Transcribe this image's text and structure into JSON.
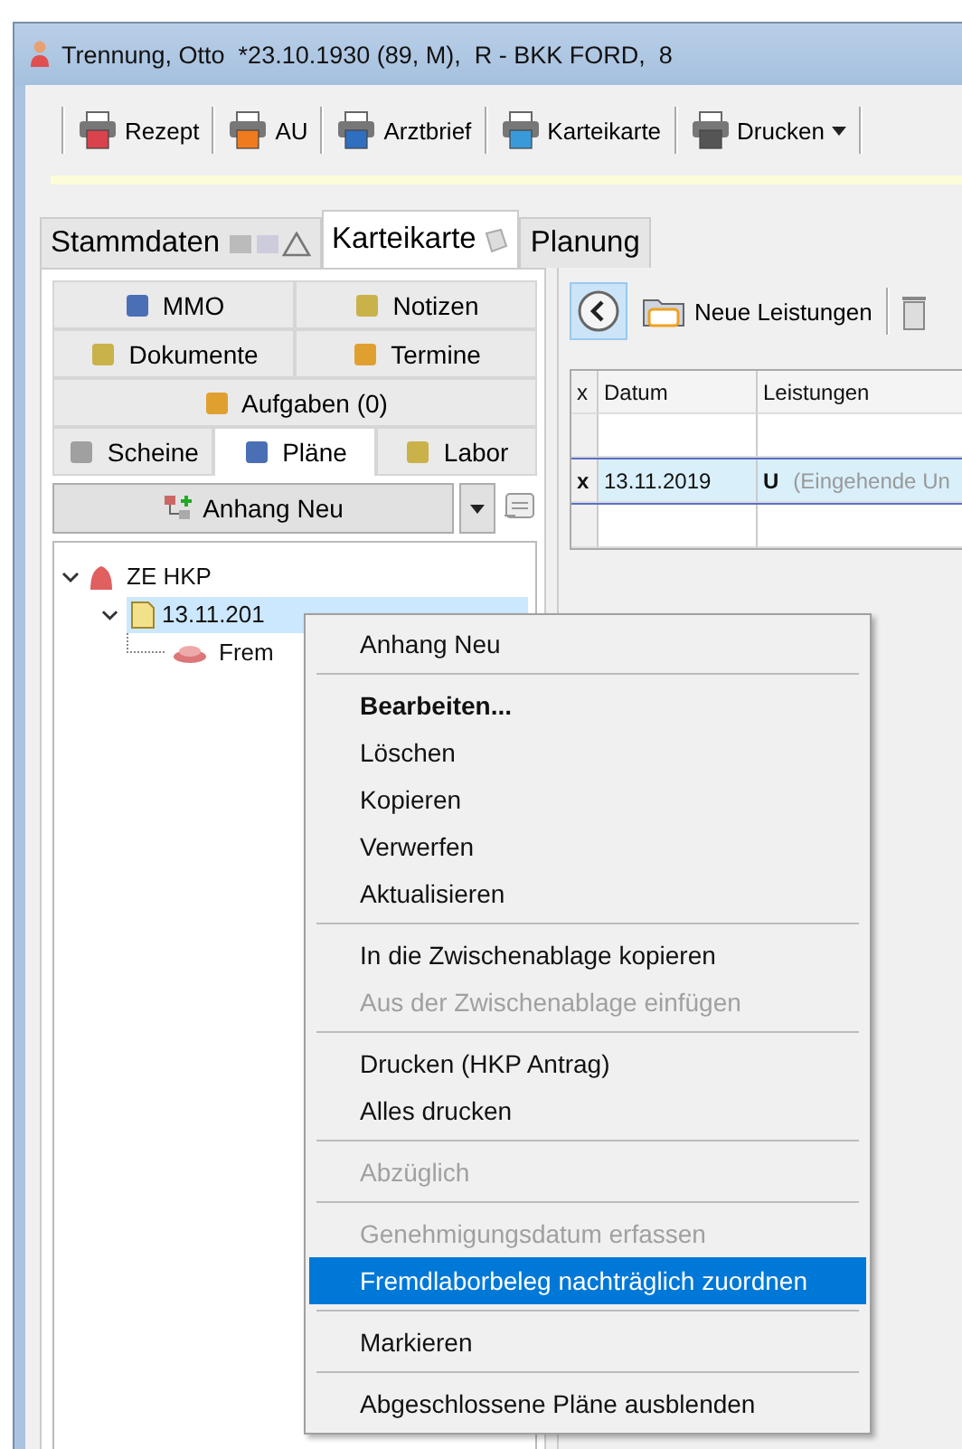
{
  "window": {
    "title": "Trennung, Otto  *23.10.1930 (89, M),  R - BKK FORD,  8"
  },
  "toolbar": [
    {
      "label": "Rezept",
      "has_menu": false
    },
    {
      "label": "AU",
      "has_menu": false
    },
    {
      "label": "Arztbrief",
      "has_menu": false
    },
    {
      "label": "Karteikarte",
      "has_menu": false
    },
    {
      "label": "Drucken",
      "has_menu": true
    }
  ],
  "main_tabs": [
    {
      "label": "Stammdaten",
      "selected": false
    },
    {
      "label": "Karteikarte",
      "selected": true
    },
    {
      "label": "Planung",
      "selected": false
    }
  ],
  "sub_tabs": [
    [
      {
        "label": "MMO",
        "selected": false
      },
      {
        "label": "Notizen",
        "selected": false
      }
    ],
    [
      {
        "label": "Dokumente",
        "selected": false
      },
      {
        "label": "Termine",
        "selected": false
      }
    ],
    [
      {
        "label": "Aufgaben (0)",
        "selected": false
      }
    ],
    [
      {
        "label": "Scheine",
        "selected": false
      },
      {
        "label": "Pläne",
        "selected": true
      },
      {
        "label": "Labor",
        "selected": false
      }
    ]
  ],
  "attach_button": {
    "label": "Anhang Neu"
  },
  "tree": [
    {
      "label": "ZE HKP",
      "expanded": true,
      "selected": false,
      "children": [
        {
          "label": "13.11.201",
          "expanded": true,
          "selected": true,
          "children": [
            {
              "label": "Frem",
              "selected": false
            }
          ]
        }
      ]
    }
  ],
  "right_toolbar": {
    "new_button": "Neue Leistungen"
  },
  "table": {
    "columns": [
      "x",
      "Datum",
      "Leistungen"
    ],
    "rows": [
      {
        "selected": false
      },
      {
        "selected": true,
        "mark": "x",
        "date": "13.11.2019",
        "code": "U",
        "description": "(Eingehende Un"
      }
    ]
  },
  "context_menu": [
    [
      {
        "label": "Anhang Neu",
        "bold": false,
        "disabled": false,
        "selected": false
      }
    ],
    [
      {
        "label": "Bearbeiten...",
        "bold": true,
        "disabled": false,
        "selected": false
      },
      {
        "label": "Löschen",
        "bold": false,
        "disabled": false,
        "selected": false
      },
      {
        "label": "Kopieren",
        "bold": false,
        "disabled": false,
        "selected": false
      },
      {
        "label": "Verwerfen",
        "bold": false,
        "disabled": false,
        "selected": false
      },
      {
        "label": "Aktualisieren",
        "bold": false,
        "disabled": false,
        "selected": false
      }
    ],
    [
      {
        "label": "In die Zwischenablage kopieren",
        "bold": false,
        "disabled": false,
        "selected": false
      },
      {
        "label": "Aus der Zwischenablage einfügen",
        "bold": false,
        "disabled": true,
        "selected": false
      }
    ],
    [
      {
        "label": "Drucken (HKP Antrag)",
        "bold": false,
        "disabled": false,
        "selected": false
      },
      {
        "label": "Alles drucken",
        "bold": false,
        "disabled": false,
        "selected": false
      }
    ],
    [
      {
        "label": "Abzüglich",
        "bold": false,
        "disabled": true,
        "selected": false
      }
    ],
    [
      {
        "label": "Genehmigungsdatum erfassen",
        "bold": false,
        "disabled": true,
        "selected": false
      },
      {
        "label": "Fremdlaborbeleg nachträglich zuordnen",
        "bold": false,
        "disabled": false,
        "selected": true
      }
    ],
    [
      {
        "label": "Markieren",
        "bold": false,
        "disabled": false,
        "selected": false
      }
    ],
    [
      {
        "label": "Abgeschlossene Pläne ausblenden",
        "bold": false,
        "disabled": false,
        "selected": false
      }
    ]
  ]
}
